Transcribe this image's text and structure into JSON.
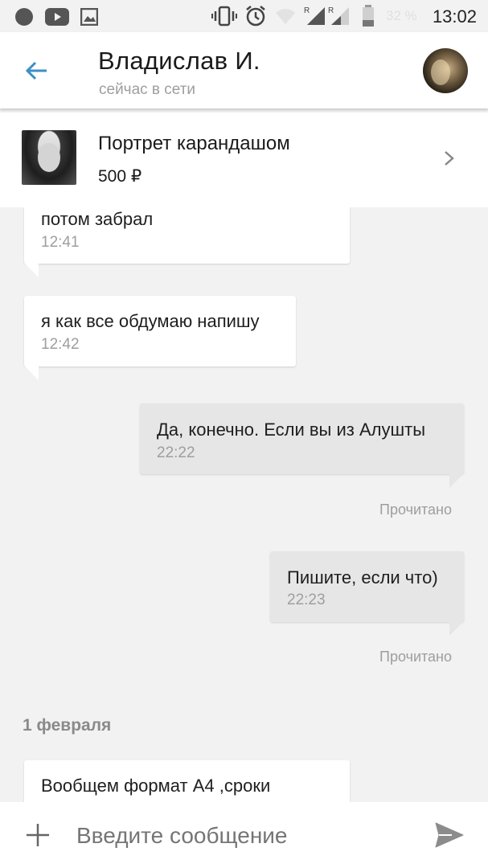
{
  "status_bar": {
    "time": "13:02",
    "battery": "32 %",
    "icons": [
      "record-icon",
      "youtube-icon",
      "gallery-icon",
      "vibrate-icon",
      "alarm-icon",
      "wifi-icon",
      "signal-icon",
      "signal-icon",
      "battery-icon"
    ]
  },
  "header": {
    "contact_name": "Владислав И.",
    "presence": "сейчас в сети",
    "back_icon": "arrow-left-icon",
    "accent": "#3d8fc4"
  },
  "product": {
    "title": "Портрет карандашом",
    "price": "500 ₽",
    "chevron_icon": "chevron-right-icon"
  },
  "messages": [
    {
      "direction": "in",
      "text": "потом забрал",
      "time": "12:41"
    },
    {
      "direction": "in",
      "text": "я как все обдумаю напишу",
      "time": "12:42"
    },
    {
      "direction": "out",
      "text": "Да, конечно. Если вы из Алушты",
      "time": "22:22",
      "receipt": "Прочитано"
    },
    {
      "direction": "out",
      "text": "Пишите, если что)",
      "time": "22:23",
      "receipt": "Прочитано"
    }
  ],
  "date_separator": "1 февраля",
  "last_message": {
    "direction": "in",
    "text": "Вообщем формат А4 ,сроки"
  },
  "composer": {
    "placeholder": "Введите сообщение",
    "attach_icon": "plus-icon",
    "send_icon": "send-icon"
  }
}
